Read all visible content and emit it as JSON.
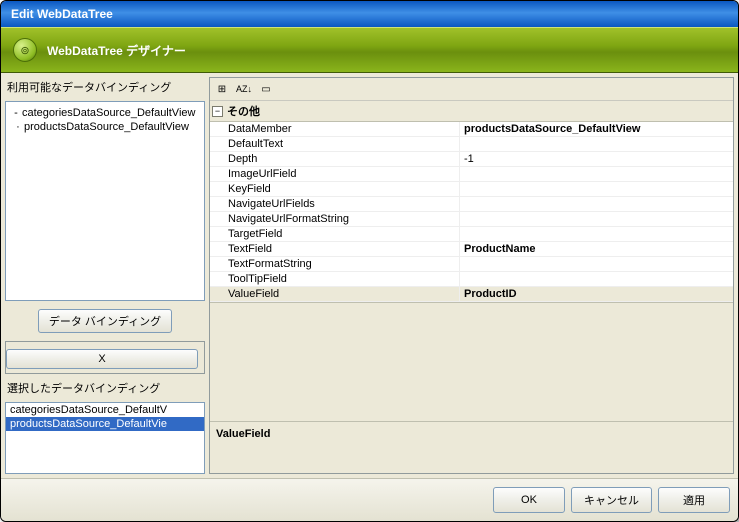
{
  "window": {
    "title": "Edit WebDataTree"
  },
  "header": {
    "title": "WebDataTree デザイナー",
    "icon": "tree-icon"
  },
  "toolbar_icons": {
    "categorized": "⊞",
    "alpha_a": "A",
    "alpha_z": "Z",
    "arrow": "↓",
    "pages": "▭"
  },
  "left": {
    "available_label": "利用可能なデータバインディング",
    "available_items": [
      "categoriesDataSource_DefaultView",
      "productsDataSource_DefaultView"
    ],
    "bind_button": "データ バインディング",
    "delete_button": "X",
    "selected_label": "選択したデータバインディング",
    "selected_items": [
      {
        "text": "categoriesDataSource_DefaultV",
        "selected": false
      },
      {
        "text": "productsDataSource_DefaultVie",
        "selected": true
      }
    ]
  },
  "propgrid": {
    "category": "その他",
    "rows": [
      {
        "name": "DataMember",
        "value": "productsDataSource_DefaultView",
        "bold": true,
        "selected": false
      },
      {
        "name": "DefaultText",
        "value": "",
        "bold": false,
        "selected": false
      },
      {
        "name": "Depth",
        "value": "-1",
        "bold": false,
        "selected": false
      },
      {
        "name": "ImageUrlField",
        "value": "",
        "bold": false,
        "selected": false
      },
      {
        "name": "KeyField",
        "value": "",
        "bold": false,
        "selected": false
      },
      {
        "name": "NavigateUrlFields",
        "value": "",
        "bold": false,
        "selected": false
      },
      {
        "name": "NavigateUrlFormatString",
        "value": "",
        "bold": false,
        "selected": false
      },
      {
        "name": "TargetField",
        "value": "",
        "bold": false,
        "selected": false
      },
      {
        "name": "TextField",
        "value": "ProductName",
        "bold": true,
        "selected": false
      },
      {
        "name": "TextFormatString",
        "value": "",
        "bold": false,
        "selected": false
      },
      {
        "name": "ToolTipField",
        "value": "",
        "bold": false,
        "selected": false
      },
      {
        "name": "ValueField",
        "value": "ProductID",
        "bold": true,
        "selected": true
      }
    ],
    "help": {
      "name": "ValueField",
      "desc": ""
    }
  },
  "footer": {
    "ok": "OK",
    "cancel": "キャンセル",
    "apply": "適用"
  }
}
